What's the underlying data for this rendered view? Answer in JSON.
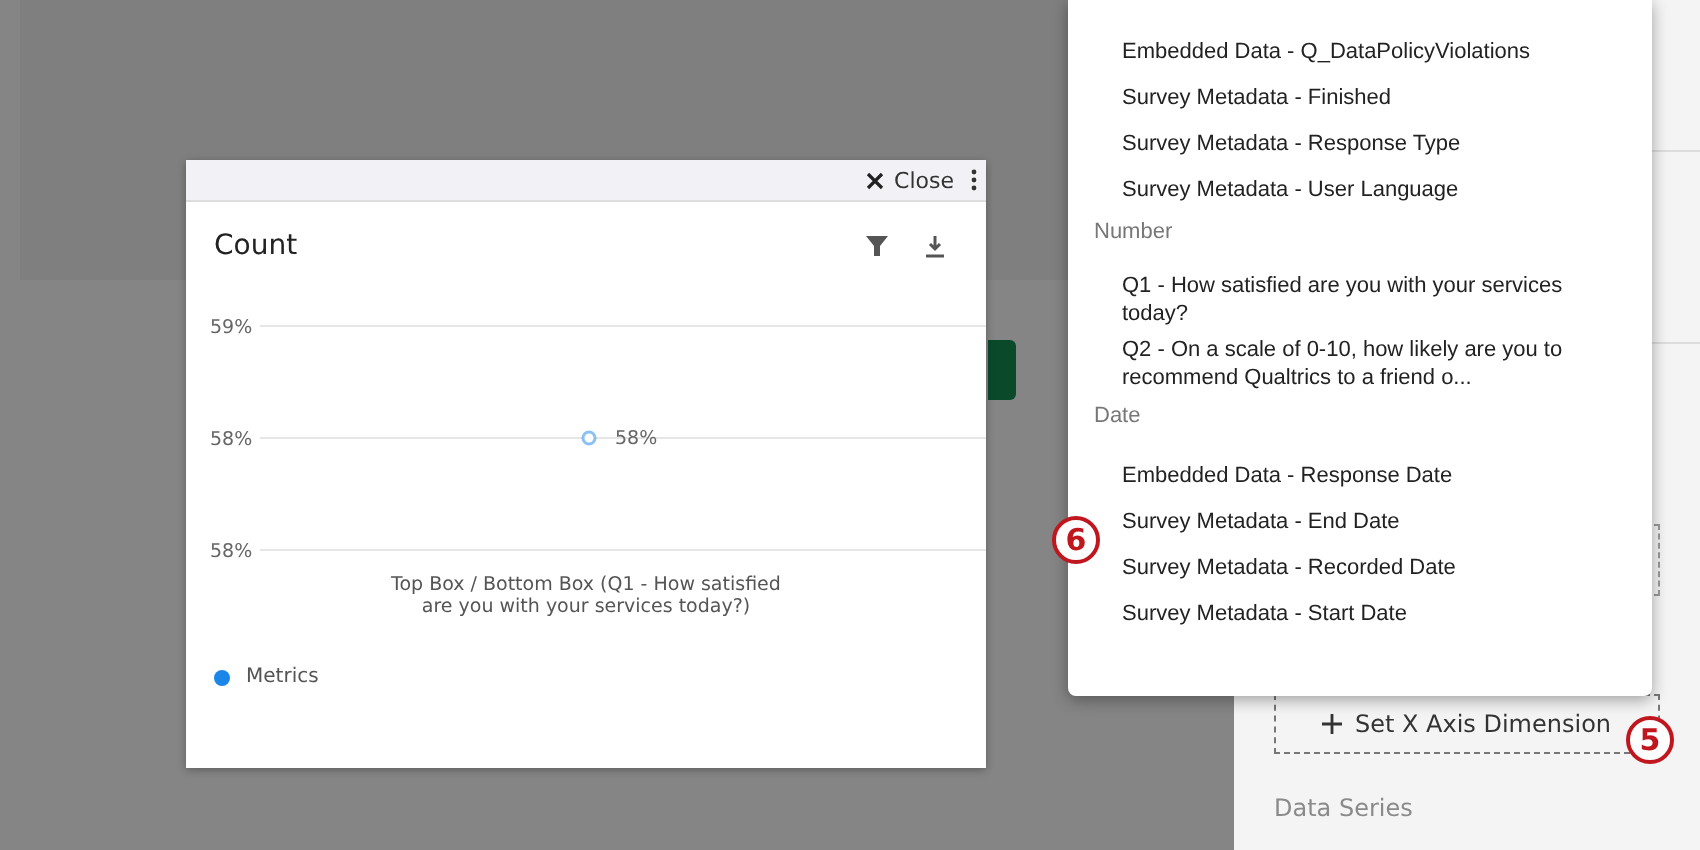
{
  "modal": {
    "close_label": "Close",
    "title": "Count",
    "chart_data": {
      "type": "line",
      "xlabel": "Top Box / Bottom Box (Q1 - How satisfied are you with your services today?)",
      "series": [
        {
          "name": "Metrics",
          "color": "#1a86e8",
          "marker": "circle",
          "values": [
            58.5
          ],
          "value_labels": [
            "58%"
          ]
        }
      ],
      "ylim": [
        58,
        59
      ],
      "yticks": [
        {
          "value": 59,
          "label": "59%"
        },
        {
          "value": 58.5,
          "label": "58%"
        },
        {
          "value": 58,
          "label": "58%"
        }
      ],
      "data_labels": true
    }
  },
  "menu_groups": [
    {
      "items": [
        "Embedded Data - Q_DataPolicyViolations",
        "Survey Metadata - Finished",
        "Survey Metadata - Response Type",
        "Survey Metadata - User Language"
      ]
    },
    {
      "header": "Number",
      "items": [
        "Q1 - How satisfied are you with your services today?",
        "Q2 - On a scale of 0-10, how likely are you to recommend Qualtrics to a friend o..."
      ]
    },
    {
      "header": "Date",
      "items": [
        "Embedded Data - Response Date",
        "Survey Metadata - End Date",
        "Survey Metadata - Recorded Date",
        "Survey Metadata - Start Date"
      ]
    }
  ],
  "sidebar": {
    "x_axis_button": "Set X Axis Dimension",
    "data_series_label": "Data Series"
  },
  "callouts": [
    {
      "label": "6"
    },
    {
      "label": "5"
    }
  ]
}
